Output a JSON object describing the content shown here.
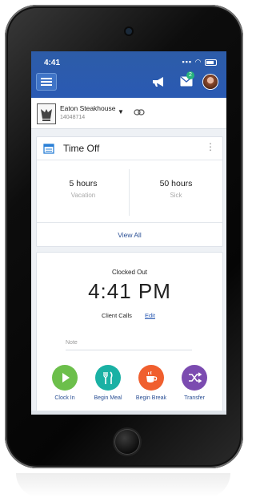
{
  "status_bar": {
    "time": "4:41",
    "signal": "▪▪▪",
    "wifi": "◠"
  },
  "header": {
    "mail_badge": "2"
  },
  "location": {
    "name": "Eaton Steakhouse",
    "id": "14048714"
  },
  "time_off": {
    "title": "Time Off",
    "columns": [
      {
        "hours": "5 hours",
        "type": "Vacation"
      },
      {
        "hours": "50 hours",
        "type": "Sick"
      }
    ],
    "view_all": "View All"
  },
  "clock": {
    "status": "Clocked Out",
    "time": "4:41 PM",
    "client_calls": "Client Calls",
    "edit": "Edit",
    "note_placeholder": "Note",
    "actions": [
      {
        "label": "Clock In",
        "color": "#6cbf4b",
        "icon": "play-icon"
      },
      {
        "label": "Begin Meal",
        "color": "#1ab1a4",
        "icon": "fork-knife-icon"
      },
      {
        "label": "Begin Break",
        "color": "#f05f2e",
        "icon": "coffee-icon"
      },
      {
        "label": "Transfer",
        "color": "#7b4bb0",
        "icon": "shuffle-icon"
      }
    ]
  }
}
